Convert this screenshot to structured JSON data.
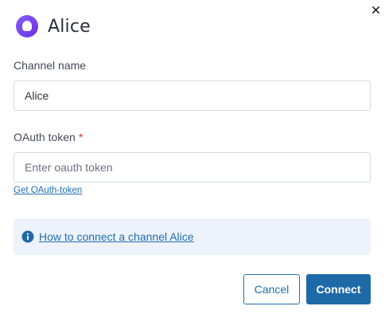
{
  "dialog": {
    "title": "Alice",
    "close_icon": "close-icon",
    "logo_icon": "alice-logo-icon"
  },
  "form": {
    "channel_name": {
      "label": "Channel name",
      "value": "Alice"
    },
    "oauth_token": {
      "label": "OAuth token",
      "required_mark": "*",
      "value": "",
      "placeholder": "Enter oauth token",
      "help_link": "Get OAuth-token"
    }
  },
  "info": {
    "icon": "info-icon",
    "link": "How to connect a channel Alice"
  },
  "actions": {
    "cancel_label": "Cancel",
    "connect_label": "Connect"
  },
  "colors": {
    "accent": "#1e6aa8",
    "link": "#1f6fb2",
    "logo": "#7c3aed",
    "required": "#d32f2f",
    "info_bg": "#eef2fa"
  }
}
